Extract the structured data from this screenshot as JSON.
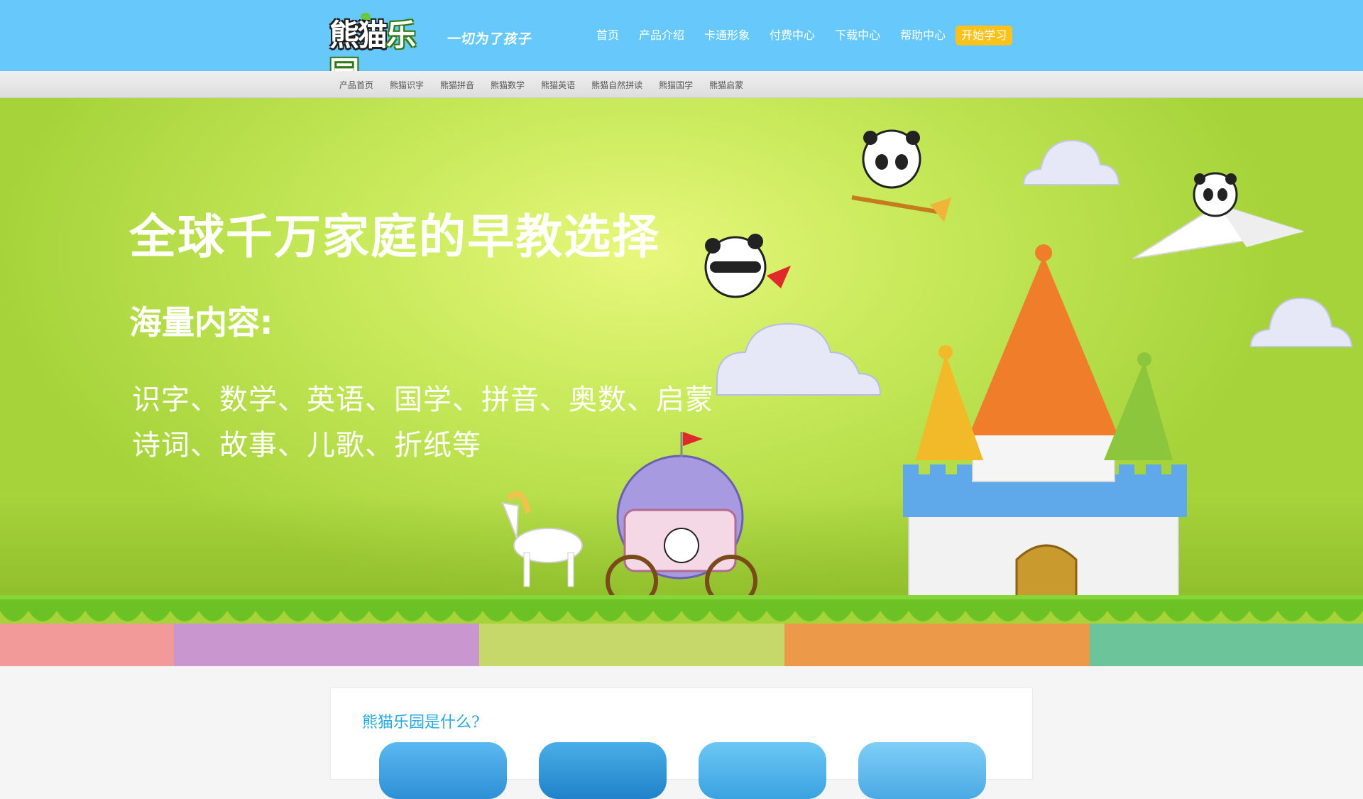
{
  "header": {
    "logo_text_a": "熊猫",
    "logo_text_b": "乐园",
    "slogan": "一切为了孩子",
    "nav": [
      "首页",
      "产品介绍",
      "卡通形象",
      "付费中心",
      "下载中心",
      "帮助中心"
    ],
    "cta": "开始学习"
  },
  "subnav": [
    "产品首页",
    "熊猫识字",
    "熊猫拼音",
    "熊猫数学",
    "熊猫英语",
    "熊猫自然拼读",
    "熊猫国学",
    "熊猫启蒙"
  ],
  "banner": {
    "title": "全球千万家庭的早教选择",
    "subtitle": "海量内容:",
    "line1": "识字、数学、英语、国学、拼音、奥数、启蒙",
    "line2": "诗词、故事、儿歌、折纸等"
  },
  "section": {
    "title": "熊猫乐园是什么?"
  },
  "colors": {
    "header_bg": "#66c8fb",
    "cta_bg": "#fcc21a",
    "banner_green": "#c7e95a",
    "grass": "#6cc224",
    "section_title": "#27a9e1",
    "strip_pink": "#f29a9a",
    "strip_purple": "#c996cf",
    "strip_olive": "#c6d86a",
    "strip_orange": "#ec9a4a",
    "strip_teal": "#6cc59a"
  }
}
